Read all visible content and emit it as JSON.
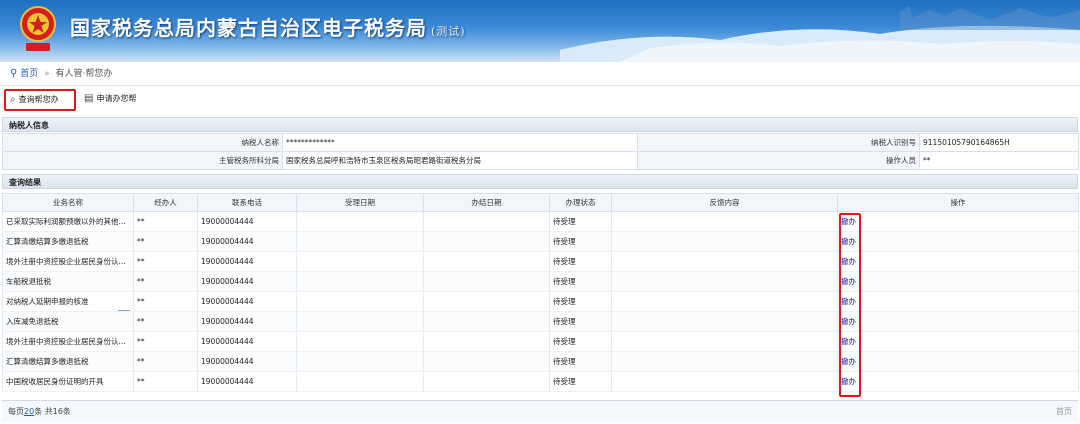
{
  "banner": {
    "title": "国家税务总局内蒙古自治区电子税务局",
    "tag": "(测试)",
    "emblem_text": "中国税务"
  },
  "breadcrumb": {
    "home": "首页",
    "separator": "»",
    "current": "有人管·帮您办"
  },
  "toolbar": {
    "query_label": "查询帮您办",
    "apply_label": "申请办您帮"
  },
  "taxpayer": {
    "section_title": "纳税人信息",
    "name_label": "纳税人名称",
    "name_value": "*************",
    "id_label": "纳税人识别号",
    "id_value": "91150105790164865H",
    "office_label": "主管税务所科分局",
    "office_value": "国家税务总局呼和浩特市玉泉区税务局昭君路街道税务分局",
    "operator_label": "操作人员",
    "operator_value": "**"
  },
  "results": {
    "section_title": "查询结果",
    "columns": [
      "业务名称",
      "经办人",
      "联系电话",
      "受理日期",
      "办结日期",
      "办理状态",
      "反馈内容",
      "操作"
    ],
    "rows": [
      {
        "name": "已采取实际利润额预缴以外的其他...",
        "handler": "**",
        "phone": "19000004444",
        "accept_date": "",
        "done_date": "",
        "status": "待受理",
        "feedback": "",
        "action": "撤办"
      },
      {
        "name": "汇算清缴结算多缴退抵税",
        "handler": "**",
        "phone": "19000004444",
        "accept_date": "",
        "done_date": "",
        "status": "待受理",
        "feedback": "",
        "action": "撤办"
      },
      {
        "name": "境外注册中资控股企业居民身份认...",
        "handler": "**",
        "phone": "19000004444",
        "accept_date": "",
        "done_date": "",
        "status": "待受理",
        "feedback": "",
        "action": "撤办"
      },
      {
        "name": "车船税退抵税",
        "handler": "**",
        "phone": "19000004444",
        "accept_date": "",
        "done_date": "",
        "status": "待受理",
        "feedback": "",
        "action": "撤办"
      },
      {
        "name": "对纳税人延期申报的核准",
        "handler": "**",
        "phone": "19000004444",
        "accept_date": "",
        "done_date": "",
        "status": "待受理",
        "feedback": "",
        "action": "撤办"
      },
      {
        "name": "入库减免退抵税",
        "handler": "**",
        "phone": "19000004444",
        "accept_date": "",
        "done_date": "",
        "status": "待受理",
        "feedback": "",
        "action": "撤办"
      },
      {
        "name": "境外注册中资控股企业居民身份认...",
        "handler": "**",
        "phone": "19000004444",
        "accept_date": "",
        "done_date": "",
        "status": "待受理",
        "feedback": "",
        "action": "撤办"
      },
      {
        "name": "汇算清缴结算多缴退抵税",
        "handler": "**",
        "phone": "19000004444",
        "accept_date": "",
        "done_date": "",
        "status": "待受理",
        "feedback": "",
        "action": "撤办"
      },
      {
        "name": "中国税收居民身份证明的开具",
        "handler": "**",
        "phone": "19000004444",
        "accept_date": "",
        "done_date": "",
        "status": "待受理",
        "feedback": "",
        "action": "撤办"
      }
    ]
  },
  "pagination": {
    "prefix": "每页",
    "page_size": "20",
    "middle": "条 共16条",
    "right": "首页"
  },
  "colors": {
    "banner_blue": "#1e6fc2",
    "highlight_red": "#e0191d",
    "link_blue": "#1a63b8"
  }
}
